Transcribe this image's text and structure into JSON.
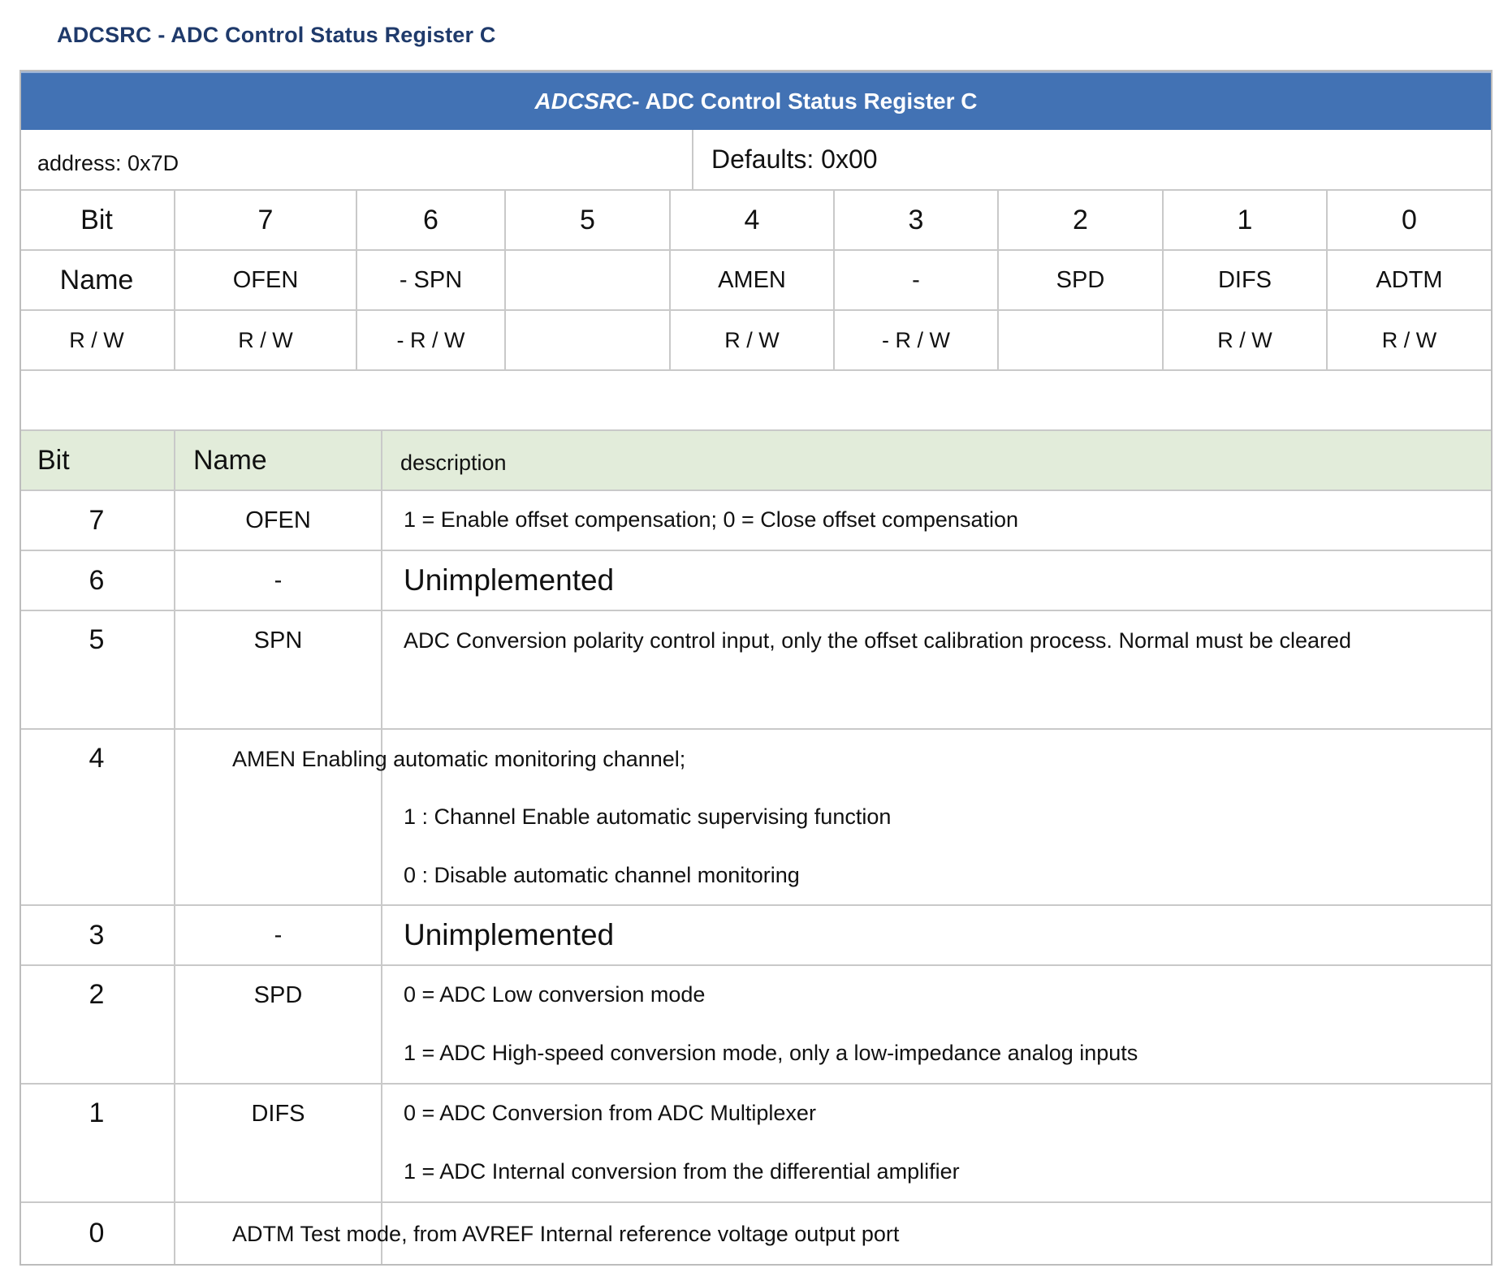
{
  "doc_title": "ADCSRC - ADC Control Status Register C",
  "register": {
    "header_abbr": "ADCSRC",
    "header_rest": " - ADC Control Status Register C",
    "address": "address: 0x7D",
    "defaults": "Defaults: 0x00",
    "bit_row_label": "Bit",
    "name_row_label": "Name",
    "rw_row_label": "R / W",
    "bits": [
      "7",
      "6",
      "5",
      "4",
      "3",
      "2",
      "1",
      "0"
    ],
    "names": [
      "OFEN",
      "- SPN",
      "",
      "AMEN",
      "-",
      "SPD",
      "DIFS",
      "ADTM"
    ],
    "rw": [
      "R / W",
      "- R / W",
      "",
      "R / W",
      "- R / W",
      "",
      "R / W",
      "R / W"
    ]
  },
  "description_table": {
    "headers": {
      "bit": "Bit",
      "name": "Name",
      "description": "description"
    },
    "rows": [
      {
        "bit": "7",
        "name": "OFEN",
        "lines": [
          "1 = Enable offset compensation; 0 = Close offset compensation"
        ]
      },
      {
        "bit": "6",
        "name": "-",
        "lines": [
          "Unimplemented"
        ]
      },
      {
        "bit": "5",
        "name": "SPN",
        "lines": [
          "ADC Conversion polarity control input, only the offset calibration process. Normal must be cleared"
        ]
      },
      {
        "bit": "4",
        "name": "",
        "lines": [
          "AMEN Enabling automatic monitoring channel;",
          "1 : Channel Enable automatic supervising function",
          "0 : Disable automatic channel monitoring"
        ]
      },
      {
        "bit": "3",
        "name": "-",
        "lines": [
          "Unimplemented"
        ]
      },
      {
        "bit": "2",
        "name": "SPD",
        "lines": [
          "0 = ADC Low conversion mode",
          "1 = ADC High-speed conversion mode, only a low-impedance analog inputs"
        ]
      },
      {
        "bit": "1",
        "name": "DIFS",
        "lines": [
          "0 = ADC Conversion from ADC Multiplexer",
          "1 = ADC Internal conversion from the differential amplifier"
        ]
      },
      {
        "bit": "0",
        "name": "",
        "lines": [
          "ADTM Test mode, from AVREF Internal reference voltage output port"
        ]
      }
    ]
  }
}
